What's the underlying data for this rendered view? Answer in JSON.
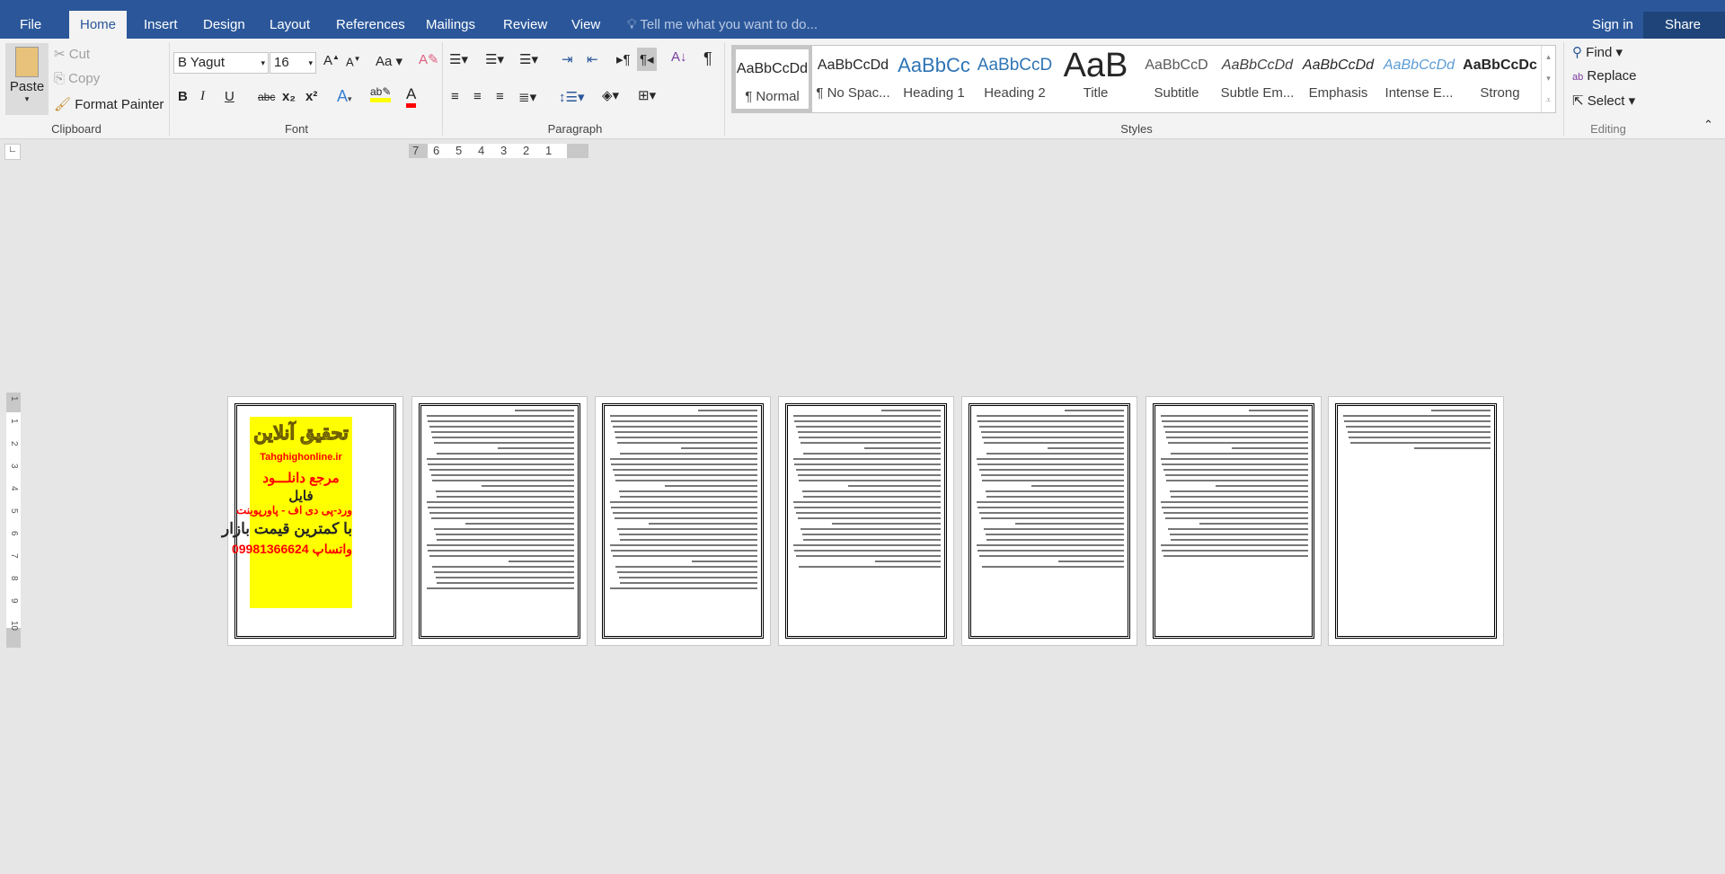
{
  "tabs": [
    "File",
    "Home",
    "Insert",
    "Design",
    "Layout",
    "References",
    "Mailings",
    "Review",
    "View"
  ],
  "tell_me": "Tell me what you want to do...",
  "sign_in": "Sign in",
  "share": "Share",
  "clipboard": {
    "paste": "Paste",
    "cut": "Cut",
    "copy": "Copy",
    "format_painter": "Format Painter",
    "label": "Clipboard"
  },
  "font": {
    "name": "B Yagut",
    "size": "16",
    "label": "Font",
    "bold": "B",
    "italic": "I",
    "underline": "U",
    "strike": "abc",
    "sub": "x₂",
    "sup": "x²",
    "case": "Aa"
  },
  "paragraph": {
    "label": "Paragraph"
  },
  "styles": {
    "label": "Styles",
    "items": [
      {
        "preview": "AaBbCcDd",
        "name": "¶ Normal"
      },
      {
        "preview": "AaBbCcDd",
        "name": "¶ No Spac..."
      },
      {
        "preview": "AaBbCc",
        "name": "Heading 1"
      },
      {
        "preview": "AaBbCcD",
        "name": "Heading 2"
      },
      {
        "preview": "AaB",
        "name": "Title"
      },
      {
        "preview": "AaBbCcD",
        "name": "Subtitle"
      },
      {
        "preview": "AaBbCcDd",
        "name": "Subtle Em..."
      },
      {
        "preview": "AaBbCcDd",
        "name": "Emphasis"
      },
      {
        "preview": "AaBbCcDd",
        "name": "Intense E..."
      },
      {
        "preview": "AaBbCcDc",
        "name": "Strong"
      }
    ]
  },
  "editing": {
    "find": "Find",
    "replace": "Replace",
    "select": "Select",
    "label": "Editing"
  },
  "ruler": [
    "7",
    "6",
    "5",
    "4",
    "3",
    "2",
    "1"
  ],
  "vruler": [
    "1",
    "1",
    "2",
    "3",
    "4",
    "5",
    "6",
    "7",
    "8",
    "9",
    "10"
  ],
  "cover": {
    "title": "تحقیق آنلاین",
    "site": "Tahghighonline.ir",
    "line1": "مرجع دانلـــود",
    "line2": "فایل",
    "line3": "ورد-پی دی اف - پاورپوینت",
    "line4": "با کمترین قیمت بازار",
    "phone": "09981366624",
    "whatsapp": "واتساپ",
    "bg": "#ffff00",
    "red": "#ff0000"
  },
  "colors": {
    "brand": "#2b579a",
    "highlight": "#ffff00",
    "font_color": "#ff0000"
  }
}
